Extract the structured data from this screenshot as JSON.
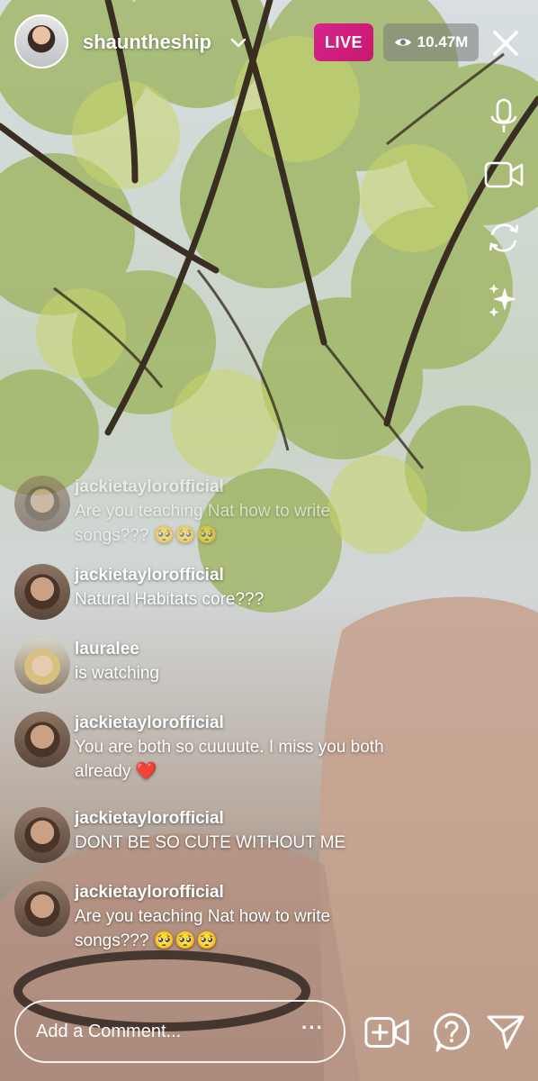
{
  "header": {
    "username": "shauntheship",
    "live_label": "LIVE",
    "viewer_count": "10.47M"
  },
  "side_tools": [
    "microphone-icon",
    "video-camera-icon",
    "flip-camera-icon",
    "sparkles-effects-icon"
  ],
  "comments": [
    {
      "user": "jackietaylorofficial",
      "text": "Are you teaching Nat how to write songs??? 🥺🥺🥺"
    },
    {
      "user": "jackietaylorofficial",
      "text": "Natural Habitats core???"
    },
    {
      "user": "lauralee",
      "text": "is watching"
    },
    {
      "user": "jackietaylorofficial",
      "text": "You are both so cuuuute. I miss you both already ❤️"
    },
    {
      "user": "jackietaylorofficial",
      "text": "DONT BE SO CUTE WITHOUT ME"
    },
    {
      "user": "jackietaylorofficial",
      "text": "Are you teaching Nat how to write songs??? 🥺🥺🥺"
    }
  ],
  "footer": {
    "comment_placeholder": "Add a Comment...",
    "more_label": "···",
    "icons": [
      "add-video-icon",
      "question-icon",
      "send-icon"
    ]
  },
  "colors": {
    "live_badge": "#d6248e",
    "viewer_badge": "rgba(120,120,120,0.55)",
    "text": "#ffffff"
  }
}
